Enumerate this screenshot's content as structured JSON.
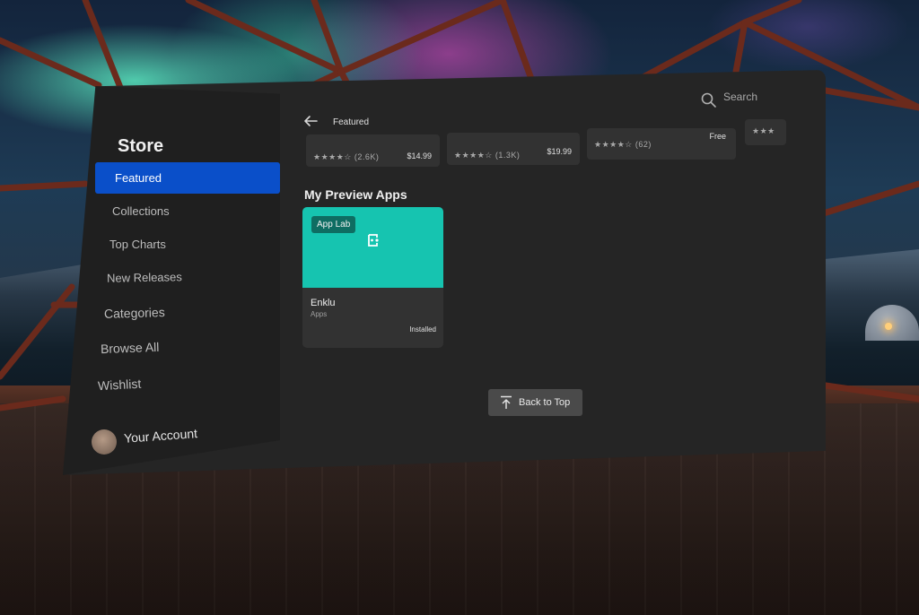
{
  "app": {
    "title": "Store"
  },
  "colors": {
    "accent": "#0a4fc9",
    "app_hero": "#16c4b0",
    "panel": "#252525",
    "sidebar": "#1f1f1f"
  },
  "sidebar": {
    "items": [
      {
        "label": "Featured",
        "active": true
      },
      {
        "label": "Collections"
      },
      {
        "label": "Top Charts"
      },
      {
        "label": "New Releases"
      },
      {
        "label": "Categories"
      },
      {
        "label": "Browse All"
      },
      {
        "label": "Wishlist"
      }
    ],
    "account_label": "Your Account"
  },
  "topbar": {
    "back_icon": "arrow-left-icon",
    "breadcrumb": "Featured",
    "search_icon": "search-icon",
    "search_label": "Search"
  },
  "featured_strip": [
    {
      "rating_text": "★★★★☆ (2.6K)",
      "price": "$14.99"
    },
    {
      "rating_text": "★★★★☆ (1.3K)",
      "price": "$19.99"
    },
    {
      "rating_text": "★★★★☆ (62)",
      "price": "Free"
    },
    {
      "rating_text": "★★★"
    }
  ],
  "preview_section": {
    "title": "My Preview Apps",
    "apps": [
      {
        "badge": "App Lab",
        "name": "Enklu",
        "category": "Apps",
        "status": "Installed",
        "logo_icon": "enklu-logo-icon"
      }
    ]
  },
  "back_to_top": {
    "label": "Back to Top",
    "icon": "arrow-up-to-line-icon"
  }
}
